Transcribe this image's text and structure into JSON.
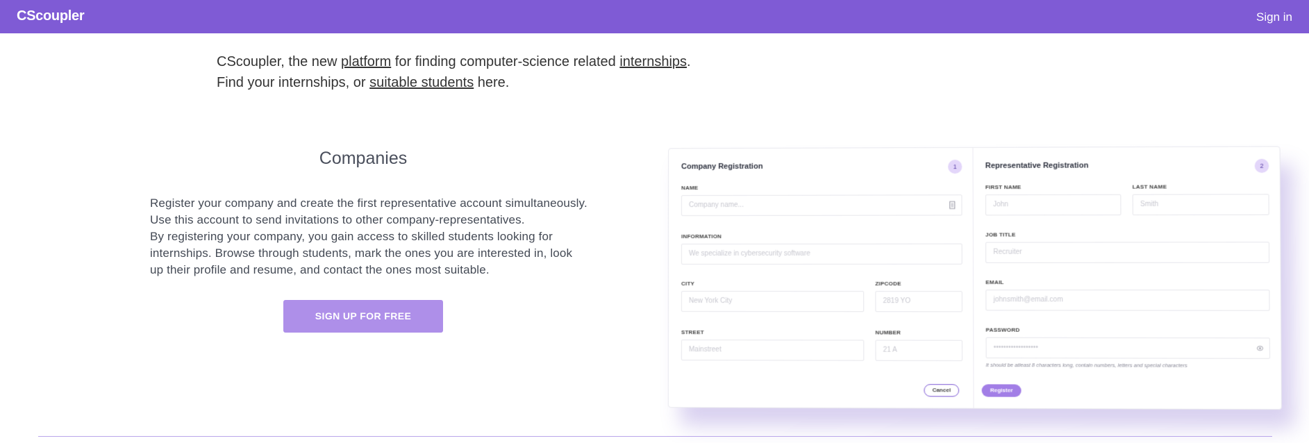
{
  "navbar": {
    "brand": "CScoupler",
    "signin": "Sign in"
  },
  "intro": {
    "line1_before": "CScoupler, the new ",
    "line1_link1": "platform",
    "line1_middle": " for finding computer-science related ",
    "line1_link2": "internships",
    "line1_end": ".",
    "line2_before": "Find your internships, or ",
    "line2_link": "suitable students",
    "line2_end": " here."
  },
  "companies": {
    "title": "Companies",
    "desc_line1": "Register your company and create the first representative account simultaneously.",
    "desc_line2": "Use this account to send invitations to other company-representatives.",
    "desc_line3": "By registering your company, you gain access to skilled students looking for internships. Browse through students, mark the ones you are interested in, look up their profile and resume, and contact the ones most suitable.",
    "signup": "SIGN UP FOR FREE"
  },
  "form": {
    "company": {
      "title": "Company Registration",
      "step": "1",
      "name_label": "NAME",
      "name_placeholder": "Company name...",
      "info_label": "INFORMATION",
      "info_placeholder": "We specialize in cybersecurity software",
      "city_label": "CITY",
      "city_placeholder": "New York City",
      "zip_label": "ZIPCODE",
      "zip_placeholder": "2819 YO",
      "street_label": "STREET",
      "street_placeholder": "Mainstreet",
      "number_label": "NUMBER",
      "number_placeholder": "21 A"
    },
    "rep": {
      "title": "Representative Registration",
      "step": "2",
      "first_label": "FIRST NAME",
      "first_placeholder": "John",
      "last_label": "LAST NAME",
      "last_placeholder": "Smith",
      "job_label": "JOB TITLE",
      "job_placeholder": "Recruiter",
      "email_label": "EMAIL",
      "email_placeholder": "johnsmith@email.com",
      "password_label": "PASSWORD",
      "password_placeholder": "••••••••••••••••••",
      "password_hint": "It should be atleast 8 characters long, contain numbers, letters and special characters"
    },
    "cancel": "Cancel",
    "register": "Register"
  }
}
